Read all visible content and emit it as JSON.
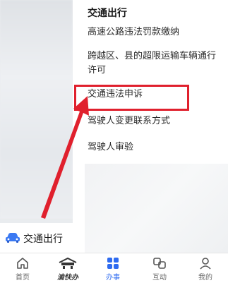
{
  "sidebar": {
    "active_item": {
      "label": "交通出行",
      "icon": "car-icon"
    }
  },
  "content": {
    "section_title": "交通出行",
    "items": [
      {
        "label": "高速公路违法罚款缴纳"
      },
      {
        "label": "跨越区、县的超限运输车辆通行许可"
      },
      {
        "label": "交通违法申诉"
      },
      {
        "label": "驾驶人变更联系方式"
      },
      {
        "label": "驾驶人审验"
      }
    ]
  },
  "tabbar": {
    "tabs": [
      {
        "label": "首页",
        "icon": "home-icon"
      },
      {
        "label": "渝快办",
        "icon": "logo-icon"
      },
      {
        "label": "办事",
        "icon": "apps-icon"
      },
      {
        "label": "互动",
        "icon": "interact-icon"
      },
      {
        "label": "我的",
        "icon": "user-icon"
      }
    ],
    "active": "办事"
  },
  "colors": {
    "accent": "#2e6bf0",
    "highlight": "#e0202d"
  }
}
